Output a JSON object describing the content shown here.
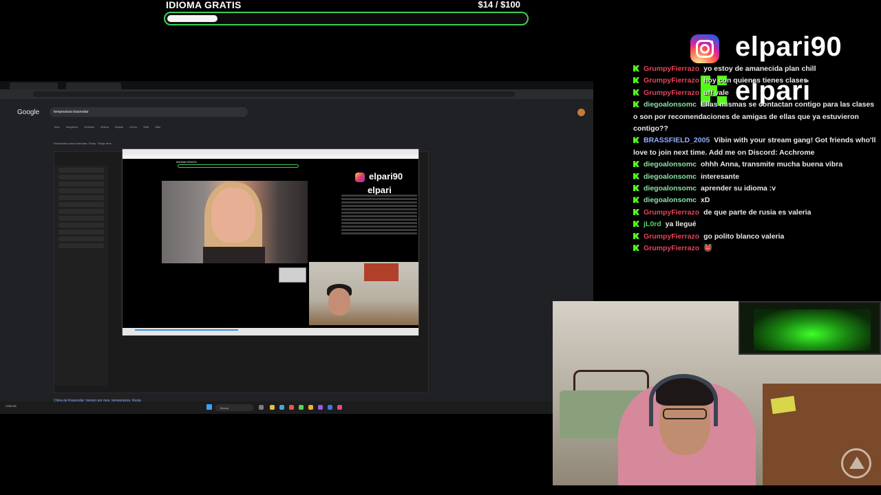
{
  "goal": {
    "title": "IDIOMA GRATIS",
    "amount": "$14  / $100",
    "progress_fraction": 0.14,
    "accent": "#3ecf5a"
  },
  "captured_screen": {
    "search_query": "temperatura krasnodar",
    "google_logo": "Google",
    "search_tabs": [
      "Todo",
      "Imágenes",
      "Noticias",
      "Videos",
      "Mapas",
      "Libros",
      "Web",
      "Más"
    ],
    "results_note": "Resultados para Krasnodar, Rusia · Elegir área",
    "bottom_result": "Clima de Krasnodar: tiempo por mes, temperatura, Rusia",
    "taskbar_search": "Buscar",
    "taskbar_weather": "COM DE",
    "nested_stream": {
      "goal_title": "IDIOMA GRATIS",
      "goal_amount": "$14  / $100",
      "handle_1": "elpari90",
      "handle_2": "elpari"
    }
  },
  "overlay": {
    "instagram_icon": "instagram-icon",
    "instagram_handle": "elpari90",
    "kick_icon": "kick-icon",
    "kick_handle": "elpari",
    "kick_color": "#53fc18"
  },
  "chat": [
    {
      "user": "GrumpyFierrazo",
      "color": "#e8435a",
      "text": "yo estoy de amanecida plan chill"
    },
    {
      "user": "GrumpyFierrazo",
      "color": "#e8435a",
      "text": "hoy con quienes tienes clases"
    },
    {
      "user": "GrumpyFierrazo",
      "color": "#e8435a",
      "text": "uff vale"
    },
    {
      "user": "diegoalonsomc",
      "color": "#8be0a4",
      "text": "Ellas mismas se contactan contigo para las clases o son por recomendaciones de amigas de ellas que ya estuvieron contigo??"
    },
    {
      "user": "BRASSFIELD_2005",
      "color": "#8fb0ff",
      "text": "Vibin with your stream gang! Got friends who'll love to join next time. Add me on Discord: Acchrome"
    },
    {
      "user": "diegoalonsomc",
      "color": "#8be0a4",
      "text": "ohhh Anna, transmite mucha buena vibra"
    },
    {
      "user": "diegoalonsomc",
      "color": "#8be0a4",
      "text": "interesante"
    },
    {
      "user": "diegoalonsomc",
      "color": "#8be0a4",
      "text": "aprender su idioma :v"
    },
    {
      "user": "diegoalonsomc",
      "color": "#8be0a4",
      "text": "xD"
    },
    {
      "user": "GrumpyFierrazo",
      "color": "#e8435a",
      "text": "de que parte de rusia es valeria"
    },
    {
      "user": "jL0rd",
      "color": "#4fd66a",
      "text": "ya llegué"
    },
    {
      "user": "GrumpyFierrazo",
      "color": "#e8435a",
      "text": "go polito blanco valeria"
    },
    {
      "user": "GrumpyFierrazo",
      "color": "#e8435a",
      "text": "👹"
    }
  ]
}
